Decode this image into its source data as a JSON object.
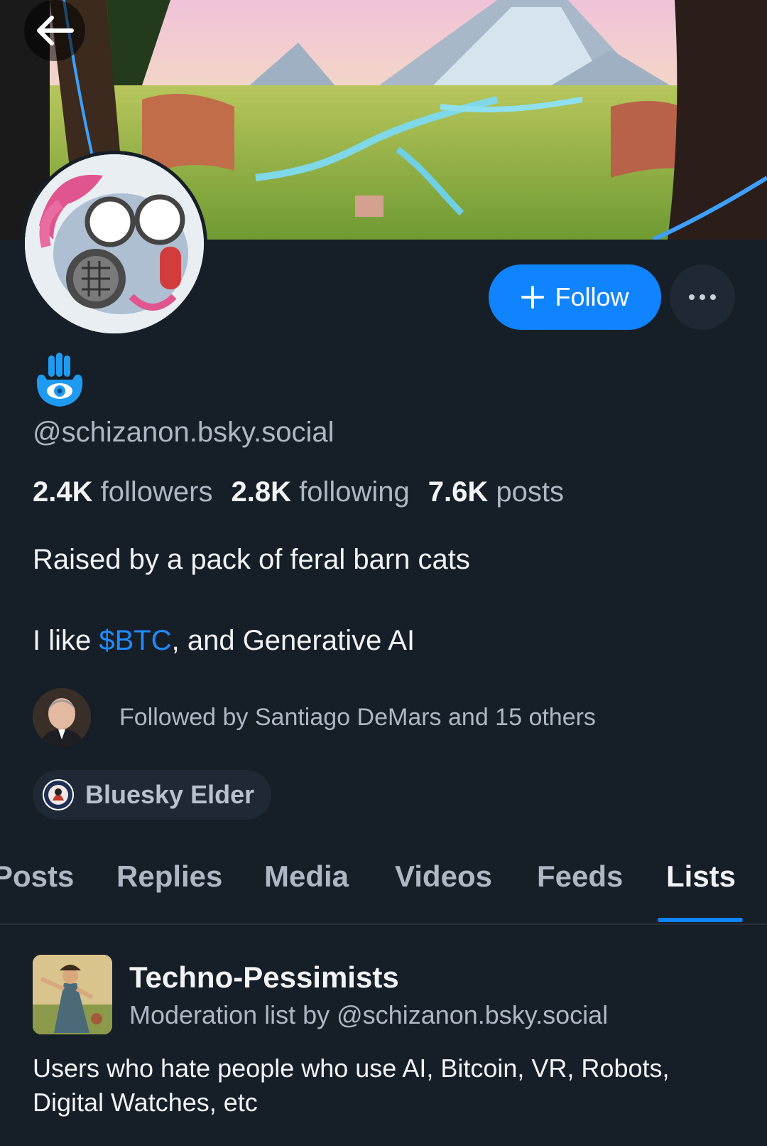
{
  "header": {
    "back_icon": "arrow-left-icon"
  },
  "actions": {
    "follow_label": "Follow",
    "follow_icon": "plus-icon",
    "more_icon": "ellipsis-icon"
  },
  "profile": {
    "display_icon": "hamsa-hand-icon",
    "handle": "@schizanon.bsky.social",
    "stats": {
      "followers_count": "2.4K",
      "followers_label": "followers",
      "following_count": "2.8K",
      "following_label": "following",
      "posts_count": "7.6K",
      "posts_label": "posts"
    },
    "bio_line1": "Raised by a pack of feral barn cats",
    "bio_line2_prefix": "I like ",
    "bio_line2_link": "$BTC",
    "bio_line2_suffix": ", and Generative AI",
    "followed_by": "Followed by Santiago DeMars and 15 others",
    "badge_label": "Bluesky Elder"
  },
  "tabs": [
    {
      "label": "Posts"
    },
    {
      "label": "Replies"
    },
    {
      "label": "Media"
    },
    {
      "label": "Videos"
    },
    {
      "label": "Feeds"
    },
    {
      "label": "Lists",
      "active": true
    }
  ],
  "lists": [
    {
      "title": "Techno-Pessimists",
      "subtitle": "Moderation list by @schizanon.bsky.social",
      "description": "Users who hate people who use AI, Bitcoin, VR, Robots, Digital Watches, etc"
    }
  ],
  "colors": {
    "background": "#161e27",
    "accent": "#1083fe",
    "link": "#208bfe",
    "muted_text": "#aeb8c4"
  }
}
